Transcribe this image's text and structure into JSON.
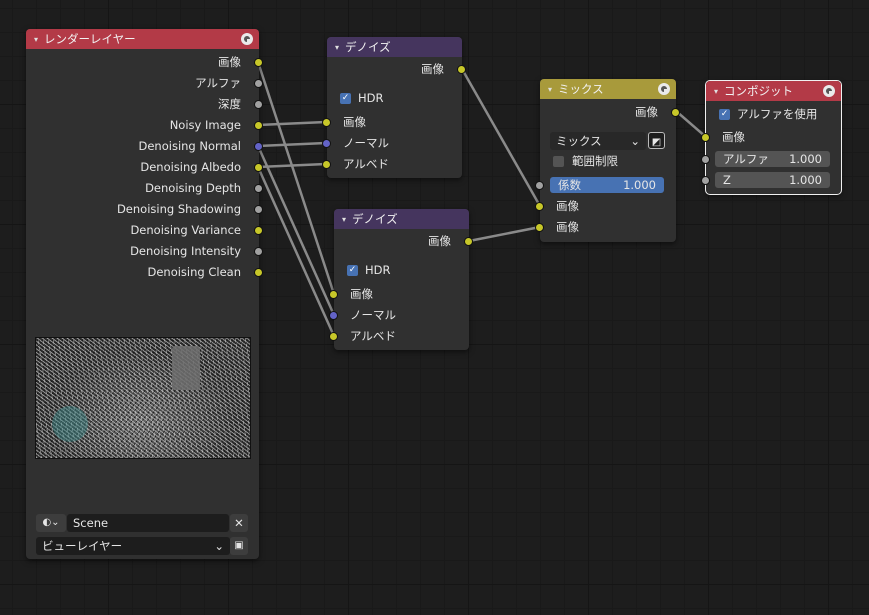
{
  "render_layers": {
    "title": "レンダーレイヤー",
    "outputs": [
      "画像",
      "アルファ",
      "深度",
      "Noisy Image",
      "Denoising Normal",
      "Denoising Albedo",
      "Denoising Depth",
      "Denoising Shadowing",
      "Denoising Variance",
      "Denoising Intensity",
      "Denoising Clean"
    ],
    "scene_name": "Scene",
    "view_layer": "ビューレイヤー"
  },
  "denoise1": {
    "title": "デノイズ",
    "output": "画像",
    "hdr_label": "HDR",
    "inputs": [
      "画像",
      "ノーマル",
      "アルベド"
    ]
  },
  "denoise2": {
    "title": "デノイズ",
    "output": "画像",
    "hdr_label": "HDR",
    "inputs": [
      "画像",
      "ノーマル",
      "アルベド"
    ]
  },
  "mix": {
    "title": "ミックス",
    "output": "画像",
    "blend_mode": "ミックス",
    "clamp_label": "範囲制限",
    "factor_label": "係数",
    "factor_value": "1.000",
    "inputs": [
      "画像",
      "画像"
    ]
  },
  "composite": {
    "title": "コンポジット",
    "use_alpha_label": "アルファを使用",
    "input_image": "画像",
    "alpha_label": "アルファ",
    "alpha_value": "1.000",
    "z_label": "Z",
    "z_value": "1.000"
  },
  "icons": {
    "collapse": "▾",
    "check": "✓",
    "close": "✕",
    "chevron": "⌄"
  },
  "colors": {
    "accent_blue": "#4772b3",
    "header_red": "#b33a47",
    "header_purple": "#45355e",
    "header_yellow": "#a89a3b",
    "socket_yellow": "#c7c729",
    "socket_gray": "#a1a1a1",
    "socket_blue": "#6363c7"
  }
}
